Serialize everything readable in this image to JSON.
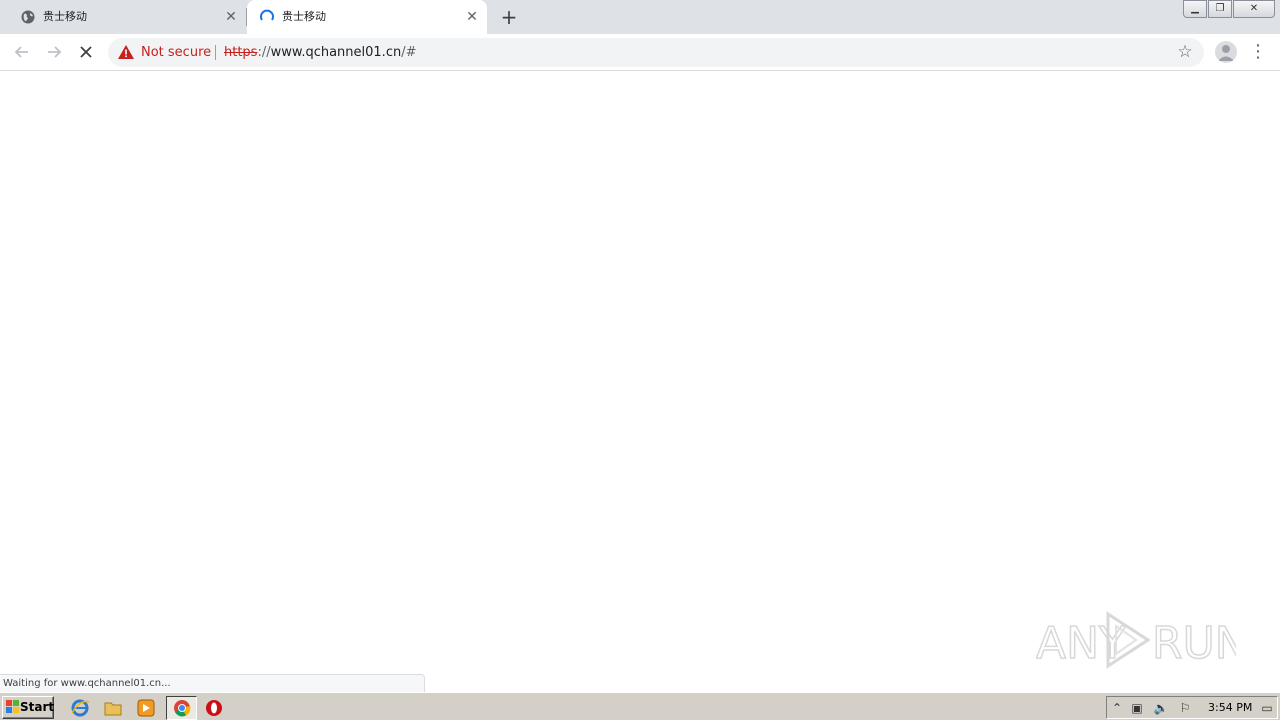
{
  "tabs": [
    {
      "title": "贵士移动",
      "state": "loaded"
    },
    {
      "title": "贵士移动",
      "state": "loading"
    }
  ],
  "newtab_icon": "plus-icon",
  "nav": {
    "back_icon": "arrow-left-icon",
    "forward_icon": "arrow-right-icon",
    "stop_icon": "close-icon"
  },
  "omnibox": {
    "security_label": "Not secure",
    "url_scheme": "https",
    "url_sep": "://",
    "url_host": "www.qchannel01.cn",
    "url_path": "/#"
  },
  "status_text": "Waiting for www.qchannel01.cn...",
  "watermark_text": "ANY RUN",
  "taskbar": {
    "start_label": "Start",
    "clock": "3:54 PM"
  },
  "colors": {
    "warning_red": "#c5221f",
    "loading_blue": "#1a73e8",
    "tabstrip_bg": "#dee1e6"
  }
}
